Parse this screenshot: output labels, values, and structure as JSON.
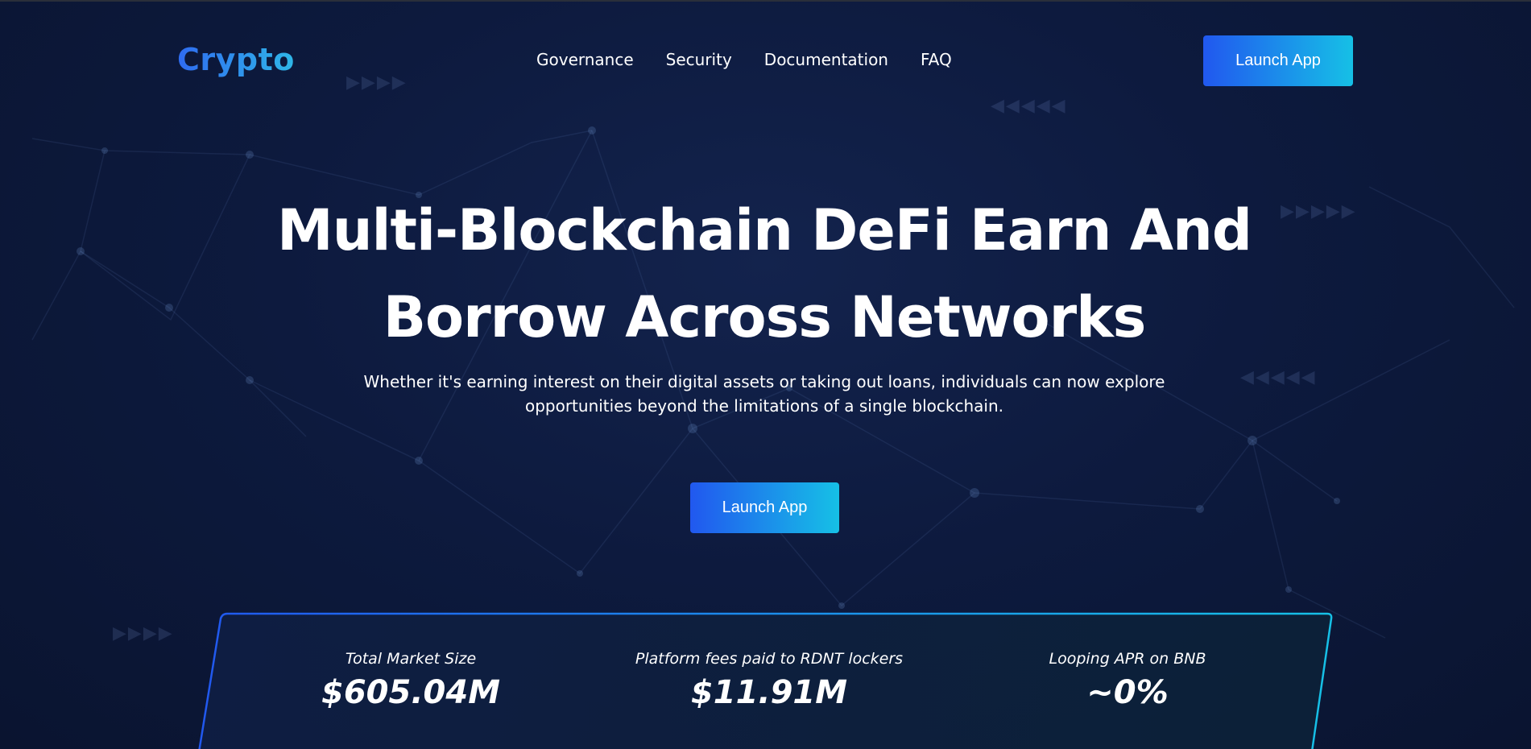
{
  "header": {
    "logo": "Crypto",
    "nav": [
      {
        "label": "Governance"
      },
      {
        "label": "Security"
      },
      {
        "label": "Documentation"
      },
      {
        "label": "FAQ"
      }
    ],
    "launch_label": "Launch App"
  },
  "hero": {
    "title_line1": "Multi-Blockchain DeFi Earn And",
    "title_line2": "Borrow Across Networks",
    "subtitle_line1": "Whether it's earning interest on their digital assets or taking out loans, individuals can now explore",
    "subtitle_line2": "opportunities beyond the limitations of a single blockchain.",
    "launch_label": "Launch App"
  },
  "stats": [
    {
      "label": "Total Market Size",
      "value": "$605.04M"
    },
    {
      "label": "Platform fees paid to RDNT lockers",
      "value": "$11.91M"
    },
    {
      "label": "Looping APR on BNB",
      "value": "~0%"
    }
  ],
  "colors": {
    "background": "#0b1636",
    "accent_start": "#2158ef",
    "accent_end": "#16c0e6"
  }
}
